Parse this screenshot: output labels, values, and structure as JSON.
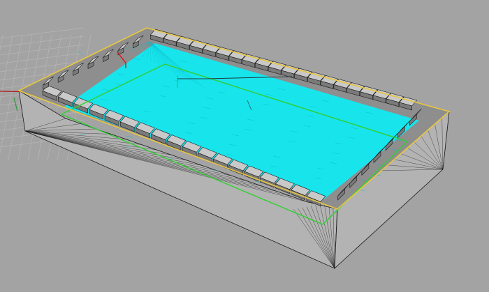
{
  "viewport": {
    "label": "",
    "colors": {
      "background": "#a3a3a3",
      "grid": "#b6b6b6",
      "axis_x": "#b21c1c",
      "axis_y": "#2a9a3a",
      "model_face": "#b3b3b3",
      "model_face_dark": "#8e8e8e",
      "model_edge": "#1a1a1a",
      "selection_outline": "#e8c640",
      "mesh_fill": "#18e4ec",
      "mesh_lines": "#08b9c7",
      "inner_curve": "#2fd02f",
      "red_curve": "#d42020"
    }
  }
}
